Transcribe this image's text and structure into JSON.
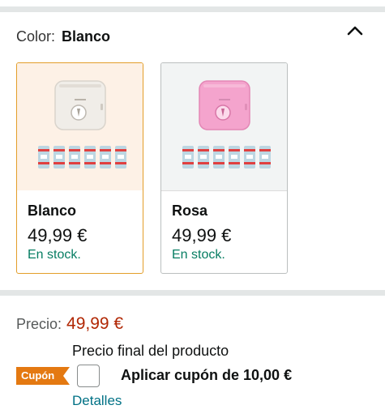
{
  "color_selector": {
    "label": "Color:",
    "selected_value": "Blanco",
    "icon": "chevron-up-icon"
  },
  "variants": [
    {
      "name": "Blanco",
      "price": "49,99 €",
      "stock": "En stock.",
      "selected": true,
      "thumb_bg": "#fdf1e6",
      "printer_color": "#f0ede8"
    },
    {
      "name": "Rosa",
      "price": "49,99 €",
      "stock": "En stock.",
      "selected": false,
      "thumb_bg": "#f2f4f4",
      "printer_color": "#f4a4cd"
    }
  ],
  "pricing": {
    "label": "Precio:",
    "value": "49,99 €",
    "final_note": "Precio final del producto"
  },
  "coupon": {
    "badge": "Cupón",
    "text": "Aplicar cupón de 10,00 €",
    "details_link": "Detalles",
    "checked": false
  },
  "colors": {
    "accent_orange": "#e39e2a",
    "price_red": "#b12704",
    "stock_green": "#067d62",
    "link_teal": "#007185",
    "coupon_orange": "#e47911"
  }
}
